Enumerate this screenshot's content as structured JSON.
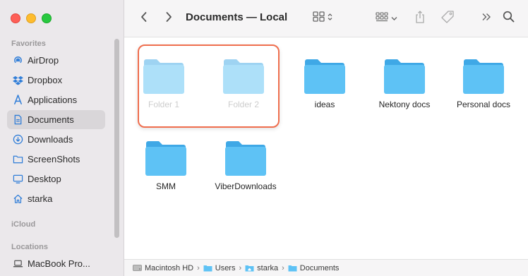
{
  "window": {
    "title": "Documents — Local"
  },
  "sidebar": {
    "favorites_label": "Favorites",
    "items": [
      {
        "label": "AirDrop",
        "icon": "airdrop-icon"
      },
      {
        "label": "Dropbox",
        "icon": "dropbox-icon"
      },
      {
        "label": "Applications",
        "icon": "applications-icon"
      },
      {
        "label": "Documents",
        "icon": "document-icon",
        "selected": true
      },
      {
        "label": "Downloads",
        "icon": "downloads-icon"
      },
      {
        "label": "ScreenShots",
        "icon": "folder-icon"
      },
      {
        "label": "Desktop",
        "icon": "desktop-icon"
      },
      {
        "label": "starka",
        "icon": "home-icon"
      }
    ],
    "icloud_label": "iCloud",
    "locations_label": "Locations",
    "locations": [
      {
        "label": "MacBook Pro...",
        "icon": "laptop-icon"
      }
    ]
  },
  "content": {
    "folders": [
      {
        "name": "Folder 1",
        "dimmed": true
      },
      {
        "name": "Folder 2",
        "dimmed": true
      },
      {
        "name": "ideas",
        "dimmed": false
      },
      {
        "name": "Nektony docs",
        "dimmed": false
      },
      {
        "name": "Personal docs",
        "dimmed": false
      },
      {
        "name": "SMM",
        "dimmed": false
      },
      {
        "name": "ViberDownloads",
        "dimmed": false
      }
    ],
    "selection_color": "#ef6e4e"
  },
  "pathbar": {
    "crumbs": [
      "Macintosh HD",
      "Users",
      "starka",
      "Documents"
    ]
  },
  "colors": {
    "folder_body": "#5ec2f5",
    "folder_tab": "#3fa8e6",
    "sidebar_bg": "#ebe8eb"
  }
}
